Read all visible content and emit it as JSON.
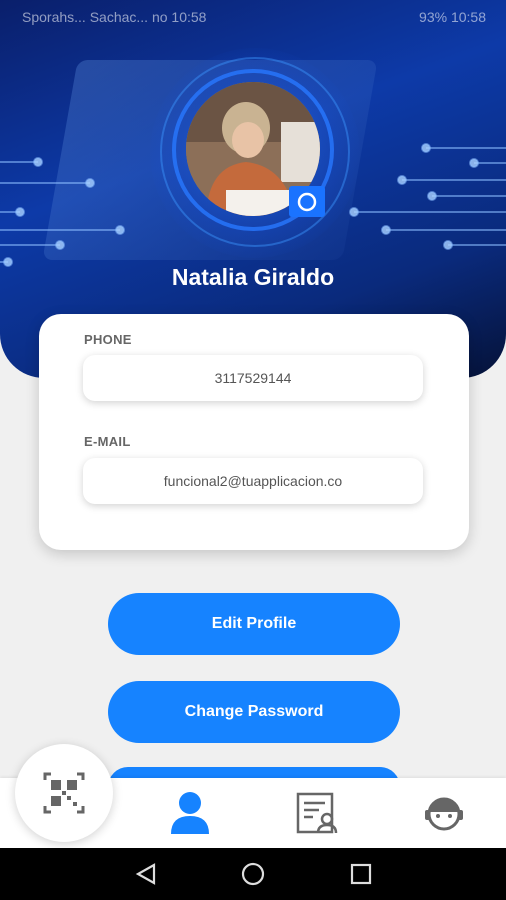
{
  "status_bar": {
    "left_text": "Sporahs... Sachac... no 10:58",
    "right_text": "93% 10:58"
  },
  "profile": {
    "name": "Natalia Giraldo"
  },
  "phone": {
    "label": "PHONE",
    "value": "3117529144"
  },
  "email": {
    "label": "E-MAIL",
    "value": "funcional2@tuapplicacion.co"
  },
  "buttons": {
    "edit_profile": "Edit Profile",
    "change_password": "Change Password"
  },
  "nav": {
    "items": [
      "qr-code",
      "profile",
      "document-user",
      "support"
    ],
    "active": "profile"
  },
  "colors": {
    "accent": "#1683ff",
    "header_dark": "#0a1f6b",
    "header_bright": "#0d3aa8"
  }
}
